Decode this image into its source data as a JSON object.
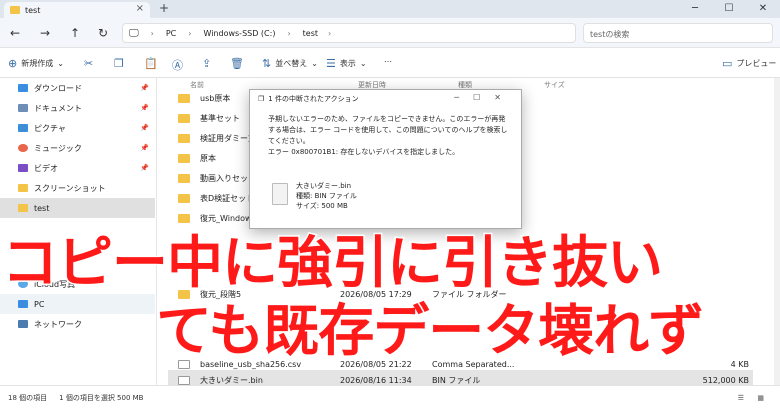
{
  "window": {
    "tab_title": "test"
  },
  "nav": {
    "path": [
      "PC",
      "Windows-SSD (C:)",
      "test"
    ],
    "search_placeholder": "testの検索"
  },
  "toolbar": {
    "new_label": "新規作成",
    "sort_label": "並べ替え",
    "view_label": "表示",
    "preview_label": "プレビュー"
  },
  "sidebar": {
    "items": [
      {
        "label": "ダウンロード",
        "color": "#3a8de0",
        "pin": true
      },
      {
        "label": "ドキュメント",
        "color": "#6d8fb5",
        "pin": true
      },
      {
        "label": "ピクチャ",
        "color": "#3d8ed8",
        "pin": true
      },
      {
        "label": "ミュージック",
        "color": "#e8674a",
        "pin": true
      },
      {
        "label": "ビデオ",
        "color": "#7a4fc5",
        "pin": true
      },
      {
        "label": "スクリーンショット",
        "color": "#f3c448",
        "pin": false
      },
      {
        "label": "test",
        "color": "#f3c448",
        "pin": false
      },
      {
        "label": "iCloud写真",
        "color": "#5aa9e6",
        "pin": false
      },
      {
        "label": "PC",
        "color": "#3a8de0",
        "pin": false
      },
      {
        "label": "ネットワーク",
        "color": "#4c7bb0",
        "pin": false
      }
    ]
  },
  "columns": {
    "name": "名前",
    "date": "更新日時",
    "type": "種類",
    "size": "サイズ"
  },
  "files": [
    {
      "name": "usb原本",
      "date": "",
      "type": "",
      "size": ""
    },
    {
      "name": "基準セット",
      "date": "",
      "type": "",
      "size": ""
    },
    {
      "name": "検証用ダミー文書",
      "date": "",
      "type": "",
      "size": ""
    },
    {
      "name": "原本",
      "date": "",
      "type": "",
      "size": ""
    },
    {
      "name": "動画入りセット",
      "date": "",
      "type": "",
      "size": ""
    },
    {
      "name": "表D検証セット",
      "date": "",
      "type": "",
      "size": ""
    },
    {
      "name": "復元_Windowsクイ",
      "date": "",
      "type": "",
      "size": ""
    },
    {
      "name": "復元_段階5",
      "date": "2026/08/05 17:29",
      "type": "ファイル フォルダー",
      "size": ""
    },
    {
      "name": "baseline_usb_sha256.csv",
      "date": "2026/08/05 21:22",
      "type": "Comma Separated...",
      "size": "4 KB"
    },
    {
      "name": "大きいダミー.bin",
      "date": "2026/08/16 11:34",
      "type": "BIN ファイル",
      "size": "512,000 KB"
    }
  ],
  "status": {
    "count": "18 個の項目",
    "selected": "1 個の項目を選択  500 MB"
  },
  "dialog": {
    "title": "1 件の中断されたアクション",
    "message": "予期しないエラーのため、ファイルをコピーできません。このエラーが再発する場合は、エラー コードを使用して、この問題についてのヘルプを検索してください。",
    "error": "エラー 0x800701B1: 存在しないデバイスを指定しました。",
    "file_name": "大きいダミー.bin",
    "file_type": "種類: BIN ファイル",
    "file_size": "サイズ: 500 MB"
  },
  "overlay": {
    "line1": "コピー中に強引に引き抜い",
    "line2": "ても既存データ壊れず"
  }
}
